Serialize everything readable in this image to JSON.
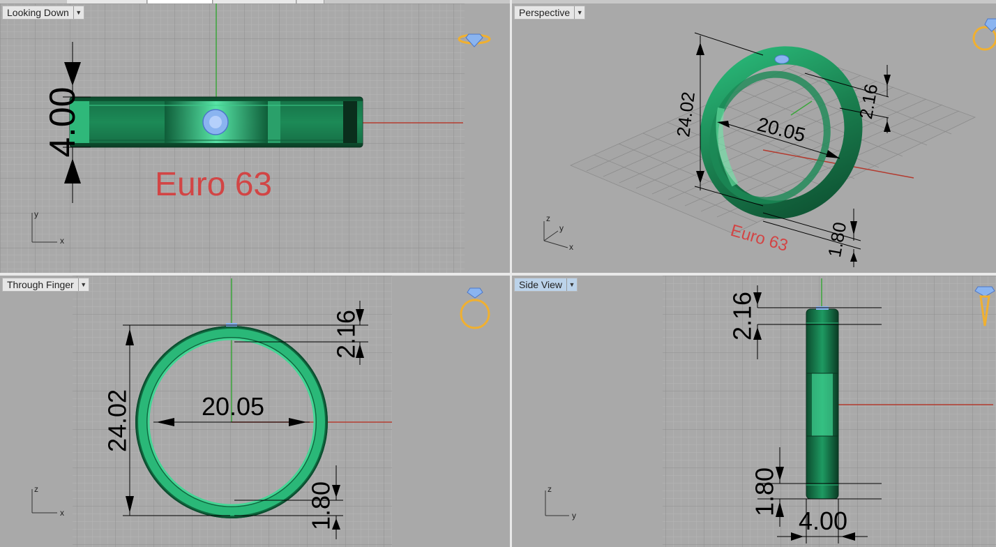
{
  "viewports": {
    "top_left": {
      "name": "Looking Down",
      "annotation": "Euro 63",
      "dimension": "4.00",
      "axis_x": "x",
      "axis_y": "y"
    },
    "top_right": {
      "name": "Perspective",
      "annotation": "Euro 63",
      "dimensions": [
        "24.02",
        "20.05",
        "2.16",
        "1.80"
      ],
      "axis_x": "x",
      "axis_y": "y",
      "axis_z": "z"
    },
    "bottom_left": {
      "name": "Through Finger",
      "dimensions": {
        "outer": "24.02",
        "inner": "20.05",
        "top": "2.16",
        "bottom": "1.80"
      },
      "axis_x": "x",
      "axis_z": "z"
    },
    "bottom_right": {
      "name": "Side View",
      "dimensions": {
        "top": "2.16",
        "bottom": "1.80",
        "width": "4.00"
      },
      "axis_y": "y",
      "axis_z": "z",
      "active": true
    }
  },
  "colors": {
    "viewport_bg": "#a9a9a9",
    "grid_minor": "#b8b8b8",
    "grid_major": "#8f8f8f",
    "ring_green": "#1f8c5a",
    "ring_highlight": "#4fe0a0",
    "axis_red": "#b33a2e",
    "axis_green": "#3aa63a",
    "annotation_red": "#d24545",
    "gem_blue": "#8ab4f0",
    "icon_gold": "#f0b030"
  }
}
